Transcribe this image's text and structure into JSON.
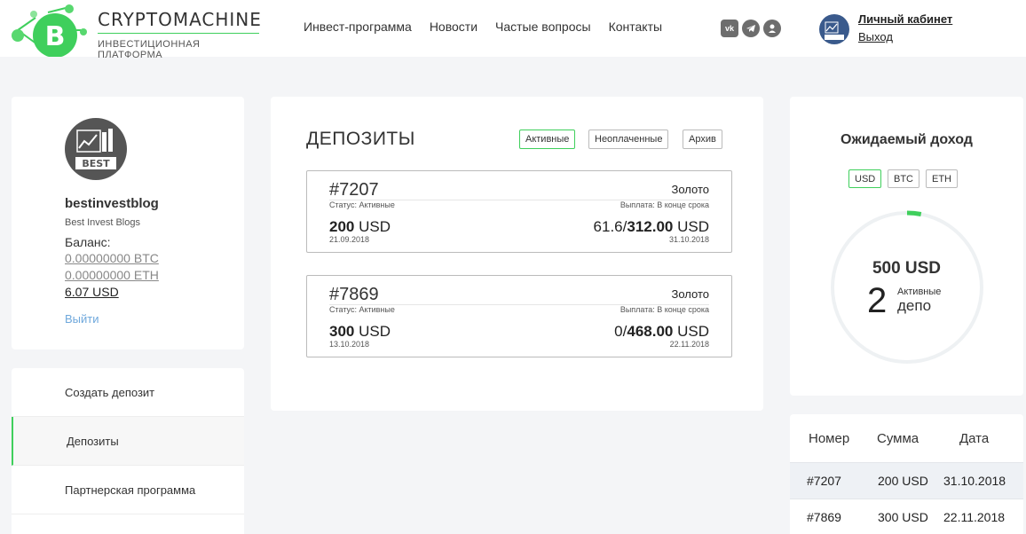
{
  "brand": {
    "title": "CRYPTOMACHINE",
    "subtitle": "ИНВЕСТИЦИОННАЯ ПЛАТФОРМА",
    "logo_icon": "bitcoin-icon",
    "accent_color": "#3fcf5c"
  },
  "nav": {
    "items": [
      "Инвест-программа",
      "Новости",
      "Частые вопросы",
      "Контакты"
    ]
  },
  "socials": [
    {
      "icon": "vk-icon"
    },
    {
      "icon": "telegram-icon"
    },
    {
      "icon": "odnoklassniki-icon"
    }
  ],
  "user": {
    "cabinet_label": "Личный кабинет",
    "logout_label": "Выход"
  },
  "profile": {
    "name": "bestinvestblog",
    "subtitle": "Best Invest Blogs",
    "balance_label": "Баланс:",
    "btc": "0.00000000 BTC",
    "eth": "0.00000000 ETH",
    "usd": "6.07 USD",
    "exit_label": "Выйти"
  },
  "menu": {
    "items": [
      {
        "label": "Создать депозит"
      },
      {
        "label": "Депозиты"
      },
      {
        "label": "Партнерская программа"
      }
    ]
  },
  "deposits": {
    "title": "ДЕПОЗИТЫ",
    "filters": [
      "Активные",
      "Неоплаченные",
      "Архив"
    ],
    "cards": [
      {
        "id": "#7207",
        "plan": "Золото",
        "status": "Статус: Активные",
        "payout": "Выплата: В конце срока",
        "amount": "200",
        "currency": "USD",
        "start_date": "21.09.2018",
        "earned": "61.6/",
        "total": "312.00",
        "end_date": "31.10.2018"
      },
      {
        "id": "#7869",
        "plan": "Золото",
        "status": "Статус: Активные",
        "payout": "Выплата: В конце срока",
        "amount": "300",
        "currency": "USD",
        "start_date": "13.10.2018",
        "earned": "0/",
        "total": "468.00",
        "end_date": "22.11.2018"
      }
    ]
  },
  "income": {
    "title": "Ожидаемый доход",
    "currencies": [
      "USD",
      "BTC",
      "ETH"
    ],
    "amount": "500 USD",
    "count": "2",
    "count_label1": "Активные",
    "count_label2": "депо",
    "ring_progress": 0.03
  },
  "table": {
    "headers": [
      "Номер",
      "Сумма",
      "Дата"
    ],
    "rows": [
      [
        "#7207",
        "200 USD",
        "31.10.2018"
      ],
      [
        "#7869",
        "300 USD",
        "22.11.2018"
      ]
    ]
  }
}
